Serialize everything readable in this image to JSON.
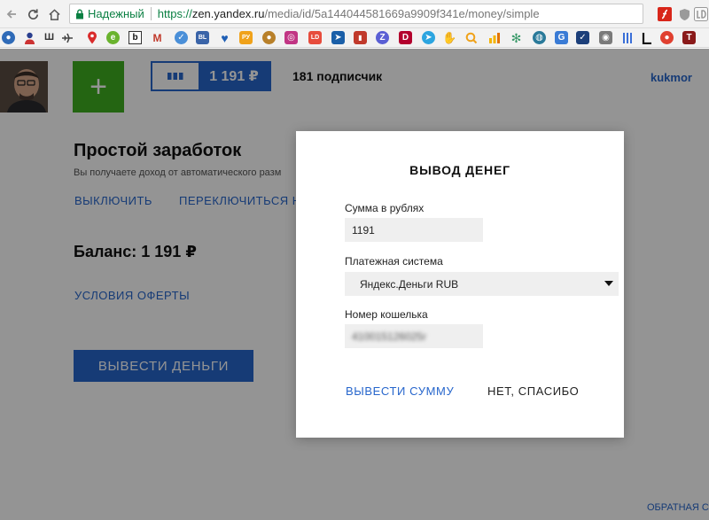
{
  "browser": {
    "secure_label": "Надежный",
    "url_scheme": "https://",
    "url_host": "zen.yandex.ru",
    "url_path": "/media/id/5a144044581669a9909f341e/money/simple",
    "bookmark_letters": {
      "sh": "Ш",
      "b": "b",
      "m": "M",
      "vl": "BL",
      "ru": "РУ",
      "ld": "LD",
      "d": "D",
      "t": "T"
    }
  },
  "header": {
    "money_amount": "1 191 ₽",
    "subscribers": "181 подписчик",
    "username": "kukmor"
  },
  "main": {
    "title": "Простой заработок",
    "description": "Вы получаете доход от автоматического разм",
    "disable_link": "ВЫКЛЮЧИТЬ",
    "switch_link": "ПЕРЕКЛЮЧИТЬСЯ НА",
    "balance": "Баланс: 1 191 ₽",
    "offer_link": "УСЛОВИЯ ОФЕРТЫ",
    "withdraw_button": "ВЫВЕСТИ ДЕНЬГИ"
  },
  "footer": {
    "feedback_link": "ОБРАТНАЯ СВЯ"
  },
  "modal": {
    "title": "ВЫВОД ДЕНЕГ",
    "amount_label": "Сумма в рублях",
    "amount_value": "1191",
    "payment_label": "Платежная система",
    "payment_value": "Яндекс.Деньги RUB",
    "wallet_label": "Номер кошелька",
    "wallet_value": "410015126025г",
    "confirm_button": "ВЫВЕСТИ СУММУ",
    "cancel_button": "НЕТ, СПАСИБО"
  },
  "colors": {
    "accent": "#2766cc",
    "add_button": "#3fae1f",
    "secure": "#0b8043"
  }
}
